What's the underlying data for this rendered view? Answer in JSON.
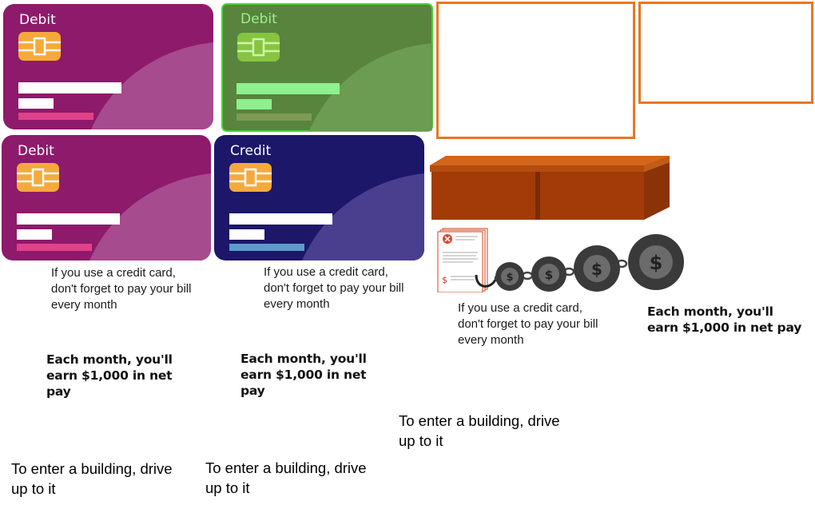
{
  "cards": [
    {
      "label": "Debit",
      "type": "debit",
      "selected": false
    },
    {
      "label": "Debit",
      "type": "debit",
      "selected": true
    },
    {
      "label": "Debit",
      "type": "debit",
      "selected": false
    },
    {
      "label": "Credit",
      "type": "credit",
      "selected": false
    }
  ],
  "colors": {
    "debit_bg": "#8e1a6b",
    "debit_wave": "#a64b8e",
    "debit_chip": "#f6a93b",
    "debit_stripe": "#e0428a",
    "credit_bg": "#1c1768",
    "credit_wave": "#4a3f8e",
    "credit_stripe": "#5b9ccc",
    "selected_bg": "#58843e",
    "selected_border": "#4cd137",
    "selected_chip": "#86c540",
    "selected_line": "#8ef08e",
    "slot_border": "#e87722",
    "desk": "#a33b08"
  },
  "tips": {
    "credit_tip": "If you use a credit card, don't forget to pay your bill every month",
    "earn_tip": "Each month, you'll earn $1,000 in net pay",
    "drive_tip": "To enter a building, drive up to it"
  },
  "icons": {
    "desk": "desk-icon",
    "bill": "bill-document-icon",
    "coin": "dollar-coin-icon",
    "chain": "chain-icon"
  }
}
